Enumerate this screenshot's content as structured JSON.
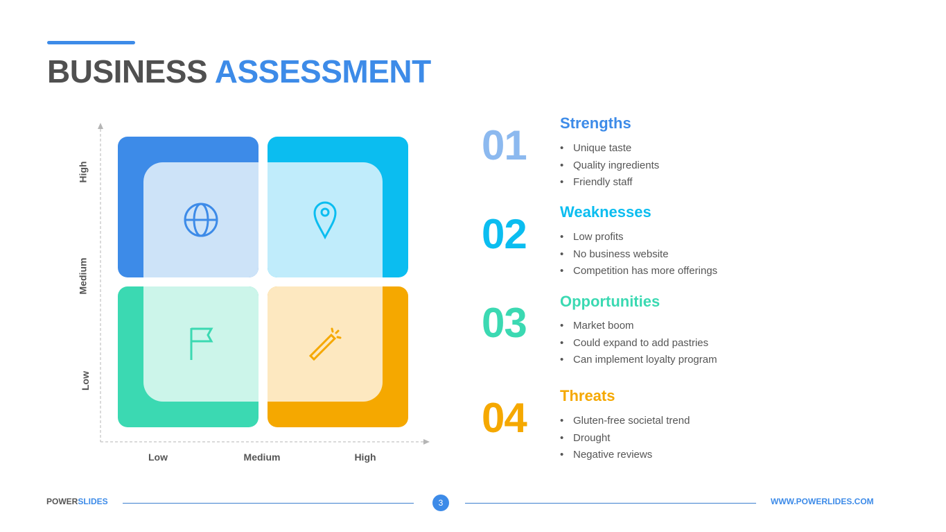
{
  "title": {
    "part1": "BUSINESS",
    "part2": "ASSESSMENT"
  },
  "colors": {
    "strengths": "#3d8be8",
    "weaknesses": "#0bbdf0",
    "opportunities": "#3bd9b2",
    "threats": "#f5a800",
    "text": "#555555"
  },
  "matrix": {
    "y_axis_labels": [
      "High",
      "Medium",
      "Low"
    ],
    "x_axis_labels": [
      "Low",
      "Medium",
      "High"
    ],
    "quadrants": [
      {
        "icon": "globe-icon",
        "color": "#3d8be8",
        "light": "#cde3f8"
      },
      {
        "icon": "map-pin-icon",
        "color": "#0bbdf0",
        "light": "#c0ecfb"
      },
      {
        "icon": "flag-icon",
        "color": "#3bd9b2",
        "light": "#ccf5ea"
      },
      {
        "icon": "magic-wand-icon",
        "color": "#f5a800",
        "light": "#fde8c0"
      }
    ]
  },
  "sections": [
    {
      "number": "01",
      "title": "Strengths",
      "items": [
        "Unique taste",
        "Quality ingredients",
        "Friendly staff"
      ]
    },
    {
      "number": "02",
      "title": "Weaknesses",
      "items": [
        "Low profits",
        "No business website",
        "Competition has more offerings"
      ]
    },
    {
      "number": "03",
      "title": "Opportunities",
      "items": [
        "Market boom",
        "Could expand to add pastries",
        "Can implement loyalty program"
      ]
    },
    {
      "number": "04",
      "title": "Threats",
      "items": [
        "Gluten-free societal trend",
        "Drought",
        "Negative reviews"
      ]
    }
  ],
  "footer": {
    "brand_part1": "POWER",
    "brand_part2": "SLIDES",
    "page": "3",
    "url": "WWW.POWERLIDES.COM"
  }
}
